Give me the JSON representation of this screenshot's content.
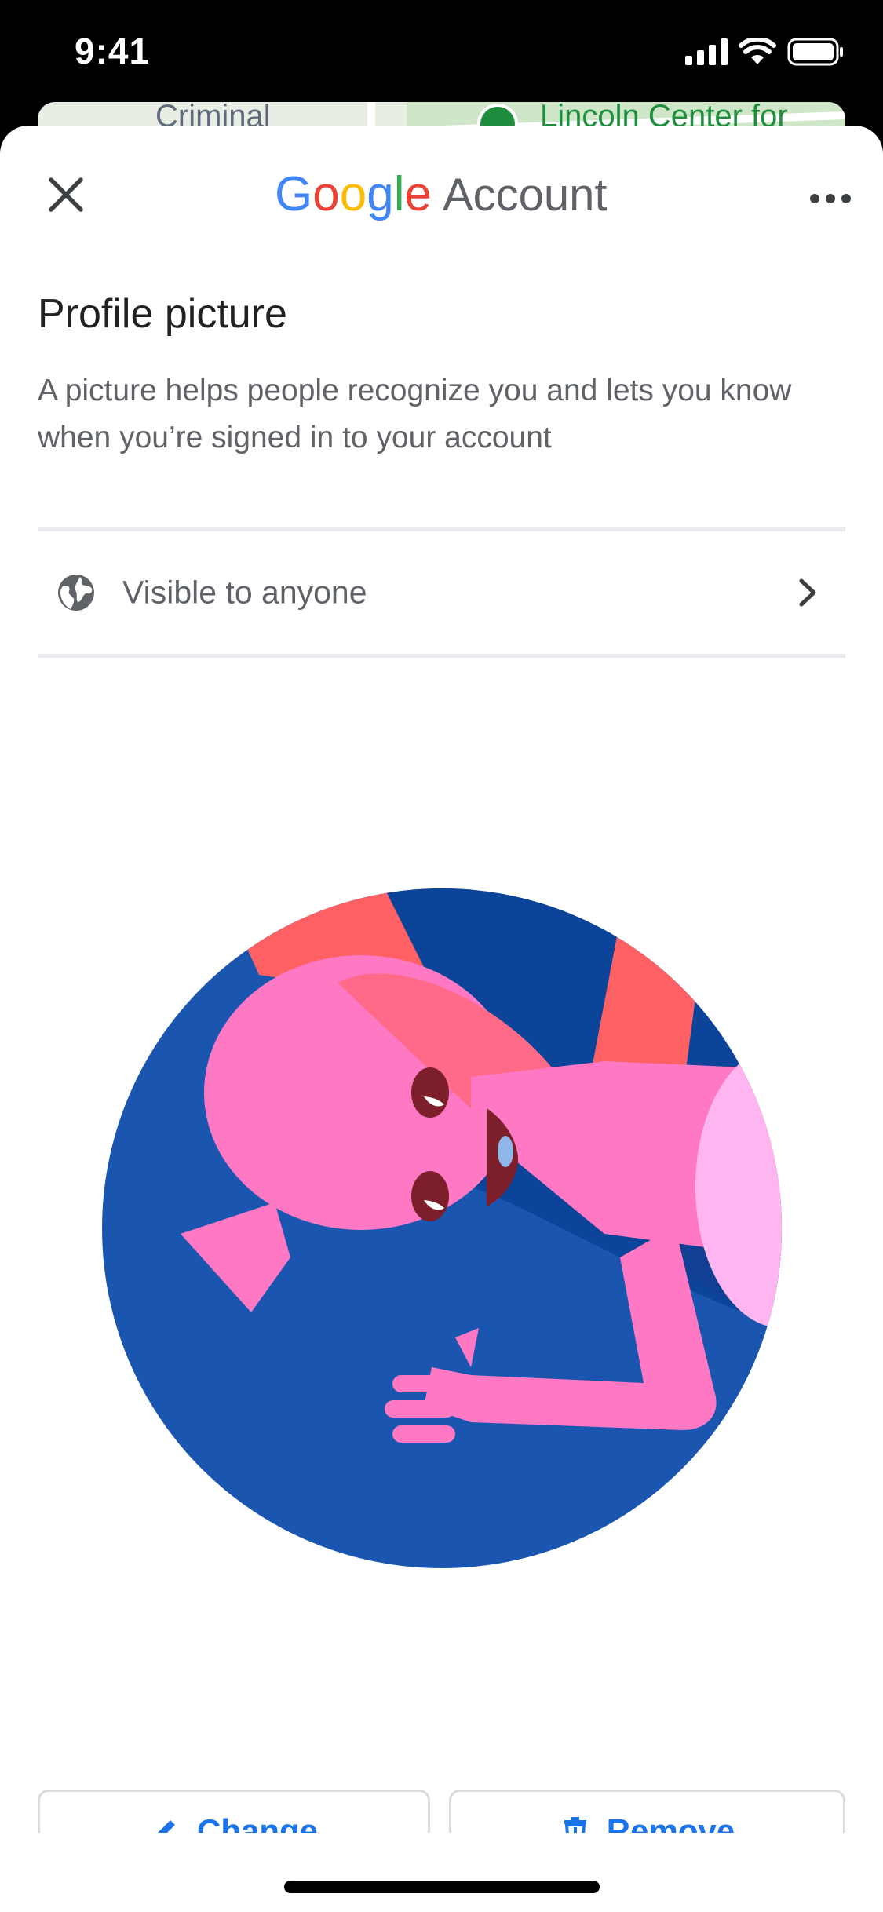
{
  "status_bar": {
    "time": "9:41"
  },
  "map": {
    "left_text": "Criminal",
    "right_text": "Lincoln Center for"
  },
  "header": {
    "logo_letters": [
      {
        "ch": "G",
        "color": "#4285F4"
      },
      {
        "ch": "o",
        "color": "#EA4335"
      },
      {
        "ch": "o",
        "color": "#FBBC05"
      },
      {
        "ch": "g",
        "color": "#4285F4"
      },
      {
        "ch": "l",
        "color": "#34A853"
      },
      {
        "ch": "e",
        "color": "#EA4335"
      }
    ],
    "logo_suffix": "Account"
  },
  "content": {
    "title": "Profile picture",
    "description": "A picture helps people recognize you and lets you know when you’re signed in to your account",
    "visibility_label": "Visible to anyone"
  },
  "actions": {
    "change_label": "Change",
    "remove_label": "Remove"
  },
  "colors": {
    "accent": "#1a73e8",
    "avatar_bg": "#1a56b0",
    "avatar_figure": "#ff78c4",
    "avatar_shadow": "#ff6064"
  }
}
